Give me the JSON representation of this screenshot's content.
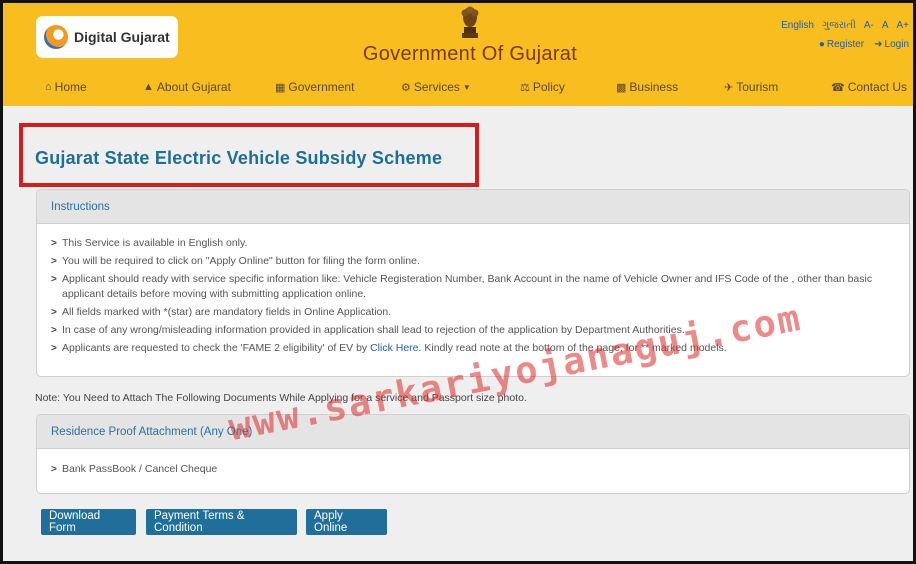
{
  "header": {
    "logo_text": "Digital Gujarat",
    "gov_title": "Government Of Gujarat",
    "languages": [
      "English",
      "ગુજરાતી",
      "A-",
      "A",
      "A+"
    ],
    "auth": {
      "register": "Register",
      "login": "Login"
    },
    "nav": [
      {
        "label": "Home",
        "icon": "home-icon"
      },
      {
        "label": "About Gujarat",
        "icon": "bell-icon"
      },
      {
        "label": "Government",
        "icon": "building-icon"
      },
      {
        "label": "Services",
        "icon": "services-icon"
      },
      {
        "label": "Policy",
        "icon": "policy-icon"
      },
      {
        "label": "Business",
        "icon": "chart-icon"
      },
      {
        "label": "Tourism",
        "icon": "tourism-icon"
      },
      {
        "label": "Contact Us",
        "icon": "phone-icon"
      }
    ]
  },
  "page_title": "Gujarat State Electric Vehicle Subsidy Scheme",
  "instructions": {
    "heading": "Instructions",
    "items": [
      "This Service is available in English only.",
      "You will be required to click on \"Apply Online\" button for filing the form online.",
      "Applicant should ready with service specific information like: Vehicle Registeration Number, Bank Account in the name of Vehicle Owner and IFS Code of the , other than basic applicant details before moving with submitting application online.",
      "All fields marked with *(star) are mandatory fields in Online Application.",
      "In case of any wrong/misleading information provided in application shall lead to rejection of the application by Department Authorities."
    ],
    "last_item": {
      "before": "Applicants are requested to check the 'FAME 2 eligibility' of EV by ",
      "link": "Click Here",
      "after": ". Kindly read note at the bottom of the page, for ** marked models."
    }
  },
  "note": "Note: You Need to Attach The Following Documents While Applying for a service and Passport size photo.",
  "residence": {
    "heading": "Residence Proof Attachment (Any One)",
    "items": [
      "Bank PassBook / Cancel Cheque"
    ]
  },
  "buttons": {
    "download_form": "Download Form",
    "payment_terms": "Payment Terms & Condition",
    "apply_online": "Apply Online"
  },
  "watermark": "www.sarkariyojanaguj.com"
}
